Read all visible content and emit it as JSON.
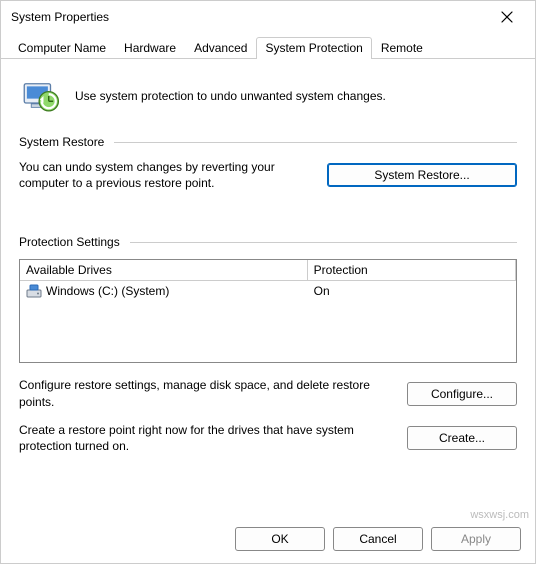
{
  "window": {
    "title": "System Properties"
  },
  "tabs": {
    "computer_name": "Computer Name",
    "hardware": "Hardware",
    "advanced": "Advanced",
    "system_protection": "System Protection",
    "remote": "Remote"
  },
  "intro_text": "Use system protection to undo unwanted system changes.",
  "restore": {
    "group_label": "System Restore",
    "text": "You can undo system changes by reverting your computer to a previous restore point.",
    "button": "System Restore..."
  },
  "protection": {
    "group_label": "Protection Settings",
    "col_drives": "Available Drives",
    "col_protection": "Protection",
    "drive_name": "Windows (C:) (System)",
    "drive_status": "On",
    "configure_text": "Configure restore settings, manage disk space, and delete restore points.",
    "configure_button": "Configure...",
    "create_text": "Create a restore point right now for the drives that have system protection turned on.",
    "create_button": "Create..."
  },
  "footer": {
    "ok": "OK",
    "cancel": "Cancel",
    "apply": "Apply"
  },
  "watermark": "wsxwsj.com"
}
